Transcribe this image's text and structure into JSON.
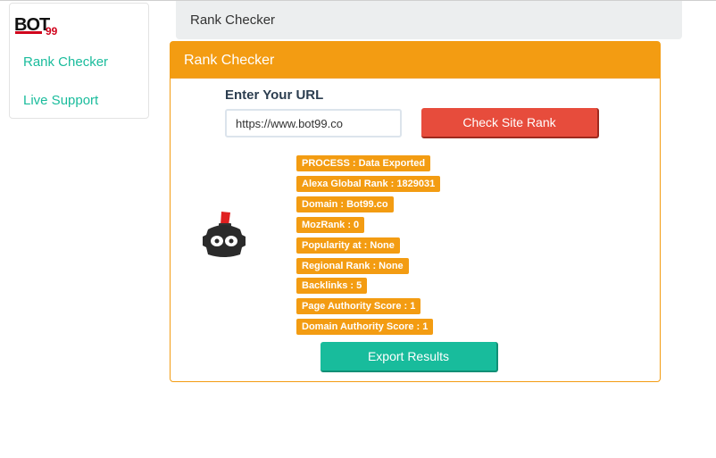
{
  "logo": {
    "text": "BOT99"
  },
  "sidebar": {
    "items": [
      {
        "label": "Rank Checker"
      },
      {
        "label": "Live Support"
      }
    ]
  },
  "breadcrumb": {
    "title": "Rank Checker"
  },
  "panel": {
    "title": "Rank Checker",
    "url_label": "Enter Your URL",
    "url_value": "https://www.bot99.co",
    "check_button": "Check Site Rank",
    "results": [
      "PROCESS : Data Exported",
      "Alexa Global Rank : 1829031",
      "Domain : Bot99.co",
      "MozRank : 0",
      "Popularity at : None",
      "Regional Rank : None",
      "Backlinks : 5",
      "Page Authority Score : 1",
      "Domain Authority Score : 1"
    ],
    "export_button": "Export Results"
  },
  "colors": {
    "accent": "#f39c12",
    "danger": "#e74c3c",
    "success": "#18bc9c",
    "link": "#1abc9c"
  },
  "icons": {
    "logo": "bot99-logo",
    "mascot": "robot-icon"
  }
}
